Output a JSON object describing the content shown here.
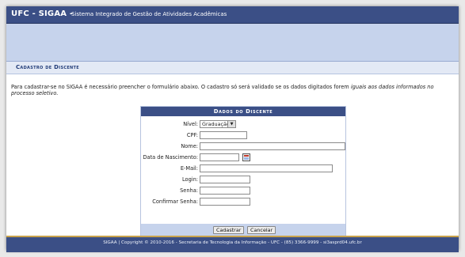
{
  "header": {
    "brand": "UFC - SIGAA -",
    "subtitle": "Sistema Integrado de Gestão de Atividades Acadêmicas"
  },
  "section": {
    "title": "Cadastro de Discente"
  },
  "intro": {
    "text": "Para cadastrar-se no SIGAA é necessário preencher o formulário abaixo. O cadastro só será validado se os dados digitados forem ",
    "emphasis": "iguais aos dados informados no processo seletivo."
  },
  "form": {
    "title": "Dados do Discente",
    "nivel_label": "Nível:",
    "nivel_value": "Graduação",
    "cpf_label": "CPF:",
    "nome_label": "Nome:",
    "nascimento_label": "Data de Nascimento:",
    "email_label": "E-Mail:",
    "login_label": "Login:",
    "senha_label": "Senha:",
    "confirmar_label": "Confirmar Senha:",
    "submit_label": "Cadastrar",
    "cancel_label": "Cancelar"
  },
  "footer": {
    "text": "SIGAA | Copyright © 2010-2016 - Secretaria de Tecnologia da Informação - UFC - (85) 3366-9999 - si3asprd04.ufc.br"
  }
}
